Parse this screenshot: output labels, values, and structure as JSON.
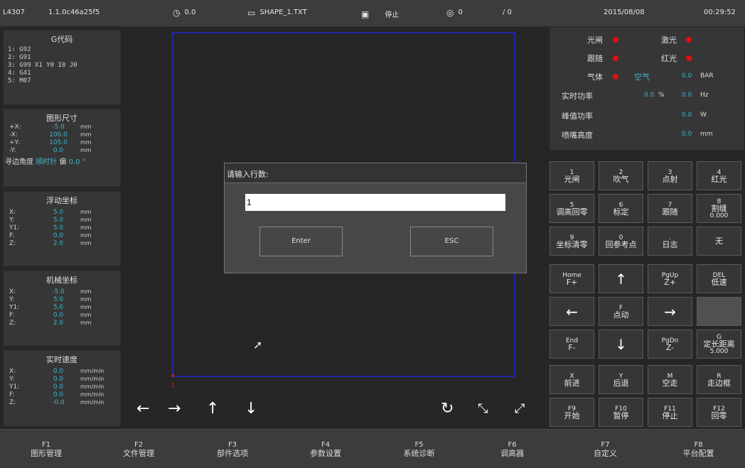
{
  "topbar": {
    "machine": "L4307",
    "version": "1.1.0c46a25f5",
    "speed": "0.0",
    "file": "SHAPE_1.TXT",
    "state": "停止",
    "count": "0",
    "progress": "/ 0",
    "date": "2015/08/08",
    "time": "00:29:52"
  },
  "gcode": {
    "title": "G代码",
    "lines": [
      "1: G92",
      "2: G91",
      "3: G99 X1 Y0 I0 J0",
      "4: G41",
      "5: M07"
    ]
  },
  "shape_size": {
    "title": "图形尺寸",
    "rows": [
      {
        "axis": "+X:",
        "value": "-5.0",
        "unit": "mm"
      },
      {
        "axis": "-X:",
        "value": "100.0",
        "unit": "mm"
      },
      {
        "axis": "+Y:",
        "value": "105.0",
        "unit": "mm"
      },
      {
        "axis": "-Y:",
        "value": "0.0",
        "unit": "mm"
      }
    ],
    "edge_label": "寻边角度",
    "edge_dir": "顺时针",
    "edge_off": "偏",
    "edge_val": "0.0 °"
  },
  "float_coord": {
    "title": "浮动坐标",
    "rows": [
      {
        "axis": "X:",
        "value": "5.0",
        "unit": "mm"
      },
      {
        "axis": "Y:",
        "value": "5.0",
        "unit": "mm"
      },
      {
        "axis": "Y1:",
        "value": "5.0",
        "unit": "mm"
      },
      {
        "axis": "F:",
        "value": "0.0",
        "unit": "mm"
      },
      {
        "axis": "Z:",
        "value": "2.0",
        "unit": "mm"
      }
    ]
  },
  "machine_coord": {
    "title": "机械坐标",
    "rows": [
      {
        "axis": "X:",
        "value": "-5.0",
        "unit": "mm"
      },
      {
        "axis": "Y:",
        "value": "5.0",
        "unit": "mm"
      },
      {
        "axis": "Y1:",
        "value": "5.0",
        "unit": "mm"
      },
      {
        "axis": "F:",
        "value": "0.0",
        "unit": "mm"
      },
      {
        "axis": "Z:",
        "value": "2.0",
        "unit": "mm"
      }
    ]
  },
  "realtime_speed": {
    "title": "实时速度",
    "rows": [
      {
        "axis": "X:",
        "value": "0.0",
        "unit": "mm/min"
      },
      {
        "axis": "Y:",
        "value": "0.0",
        "unit": "mm/min"
      },
      {
        "axis": "Y1:",
        "value": "0.0",
        "unit": "mm/min"
      },
      {
        "axis": "F:",
        "value": "0.0",
        "unit": "mm/min"
      },
      {
        "axis": "Z:",
        "value": "-0.0",
        "unit": "mm/min"
      }
    ]
  },
  "canvas": {
    "origin_label": "1",
    "nav_left": "←",
    "nav_right": "→",
    "nav_up": "↑",
    "nav_down": "↓",
    "refresh": "↻",
    "shrink": "⤡",
    "expand": "⤢"
  },
  "dialog": {
    "title": "请输入行数:",
    "input_value": "1",
    "enter": "Enter",
    "esc": "ESC"
  },
  "status": {
    "shutter": "光闸",
    "laser": "激光",
    "follow": "跟随",
    "red_light": "红光",
    "gas": "气体",
    "gas_type": "空气",
    "gas_val": "0.0",
    "gas_unit": "BAR",
    "power_label": "实时功率",
    "power_pct": "0.0",
    "power_pct_unit": "%",
    "power_hz": "0.0",
    "power_hz_unit": "Hz",
    "peak_label": "峰值功率",
    "peak_val": "0.0",
    "peak_unit": "W",
    "nozzle_label": "喷嘴高度",
    "nozzle_val": "0.0",
    "nozzle_unit": "mm",
    "led_color": "#e01010"
  },
  "keys": [
    {
      "n": "1",
      "c": "光闸"
    },
    {
      "n": "2",
      "c": "吹气"
    },
    {
      "n": "3",
      "c": "点射"
    },
    {
      "n": "4",
      "c": "红光"
    },
    {
      "n": "5",
      "c": "调高回零"
    },
    {
      "n": "6",
      "c": "标定"
    },
    {
      "n": "7",
      "c": "跟随"
    },
    {
      "n": "8",
      "c": "割缝",
      "s": "0.000"
    },
    {
      "n": "9",
      "c": "坐标清零"
    },
    {
      "n": "0",
      "c": "回参考点"
    },
    {
      "n": ".",
      "c": "日志"
    },
    {
      "n": "",
      "c": "无"
    },
    {
      "n": "Home",
      "c": "F+"
    },
    {
      "arr": "↑"
    },
    {
      "n": "PgUp",
      "c": "Z+"
    },
    {
      "n": "DEL",
      "c": "低速"
    },
    {
      "arr": "←"
    },
    {
      "n": "F",
      "c": "点动"
    },
    {
      "arr": "→"
    },
    {
      "blank": true
    },
    {
      "n": "End",
      "c": "F-"
    },
    {
      "arr": "↓"
    },
    {
      "n": "PgDn",
      "c": "Z-"
    },
    {
      "n": "G",
      "c": "定长距离",
      "s": "5.000"
    },
    {
      "n": "X",
      "c": "前进"
    },
    {
      "n": "Y",
      "c": "后退"
    },
    {
      "n": "M",
      "c": "空走"
    },
    {
      "n": "R",
      "c": "走边框"
    },
    {
      "n": "F9",
      "c": "开始"
    },
    {
      "n": "F10",
      "c": "暂停"
    },
    {
      "n": "F11",
      "c": "停止"
    },
    {
      "n": "F12",
      "c": "回零"
    }
  ],
  "fkeys": [
    {
      "n": "F1",
      "l": "图形管理"
    },
    {
      "n": "F2",
      "l": "文件管理"
    },
    {
      "n": "F3",
      "l": "部件选项"
    },
    {
      "n": "F4",
      "l": "参数设置"
    },
    {
      "n": "F5",
      "l": "系统诊断"
    },
    {
      "n": "F6",
      "l": "调高器"
    },
    {
      "n": "F7",
      "l": "自定义"
    },
    {
      "n": "F8",
      "l": "平台配置"
    }
  ]
}
